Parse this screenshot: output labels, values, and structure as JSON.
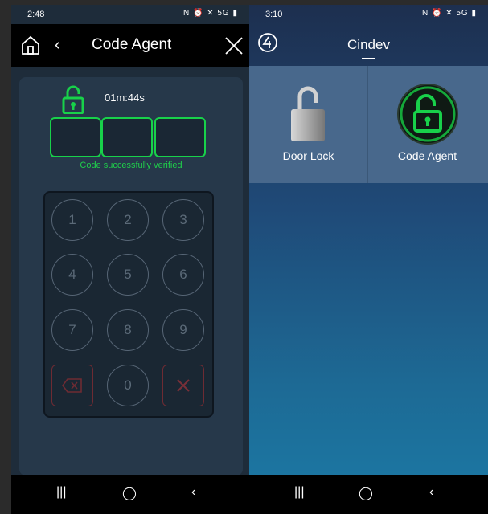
{
  "left": {
    "status": {
      "time": "2:48",
      "icons": "N ⏰ ✕ 5G ▮"
    },
    "title": "Code Agent",
    "back_glyph": "‹",
    "timer": "01m:44s",
    "verified_text": "Code successfully verified",
    "keys": [
      "1",
      "2",
      "3",
      "4",
      "5",
      "6",
      "7",
      "8",
      "9",
      "0"
    ],
    "nav": {
      "recents": "|||",
      "home": "◯",
      "back": "‹"
    }
  },
  "right": {
    "status": {
      "time": "3:10",
      "icons": "N ⏰ ✕ 5G ▮"
    },
    "title": "Cindev",
    "tiles": [
      {
        "label": "Door Lock",
        "icon": "padlock-icon"
      },
      {
        "label": "Code Agent",
        "icon": "green-lock-icon"
      }
    ],
    "nav": {
      "recents": "|||",
      "home": "◯",
      "back": "‹"
    }
  },
  "colors": {
    "accent_green": "#18d14a",
    "danger": "#6e2b33"
  }
}
